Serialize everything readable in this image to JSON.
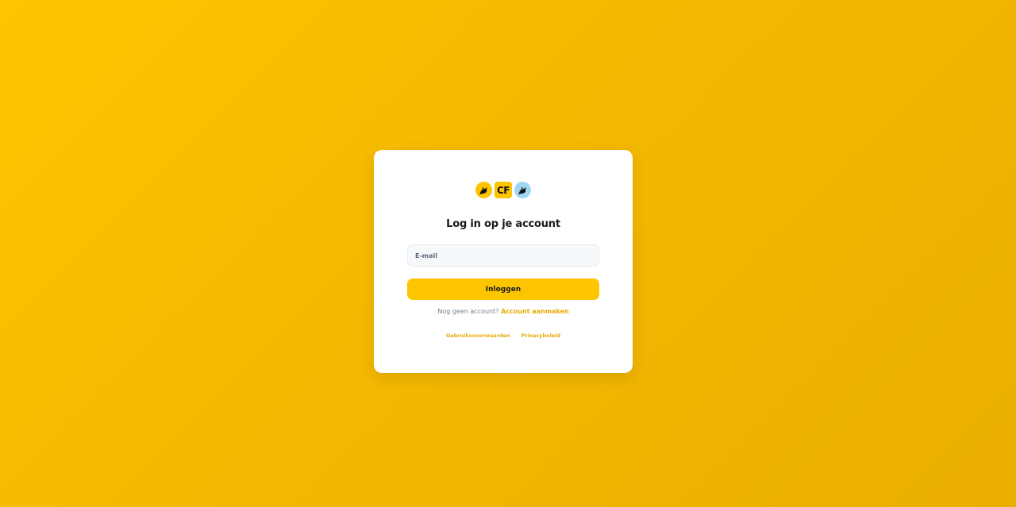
{
  "brand": {
    "monogram": "CF",
    "accent_color": "#fdc500",
    "secondary_color": "#9fd6f2",
    "icons": [
      "bird-icon",
      "cf-monogram",
      "bird-icon"
    ]
  },
  "login": {
    "title": "Log in op je account",
    "email_placeholder": "E-mail",
    "email_value": "",
    "submit_label": "Inloggen",
    "no_account_text": "Nog geen account?",
    "create_account_link": "Account aanmaken"
  },
  "footer": {
    "terms_link": "Gebruiksvoorwaarden",
    "privacy_link": "Privacybeleid"
  }
}
